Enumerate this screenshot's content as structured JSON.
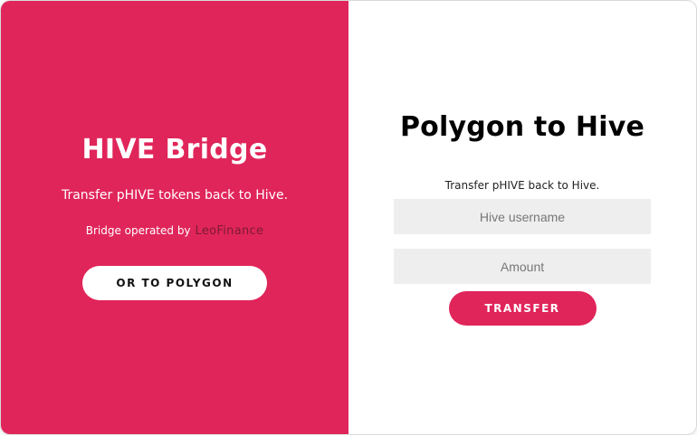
{
  "left_panel": {
    "title": "HIVE Bridge",
    "subtitle": "Transfer pHIVE tokens back to Hive.",
    "operated_by": "Bridge operated by",
    "operator_link": "LeoFinance",
    "switch_button": "OR TO POLYGON"
  },
  "right_panel": {
    "title": "Polygon to Hive",
    "subtitle": "Transfer pHIVE back to Hive.",
    "username": {
      "value": "",
      "placeholder": "Hive username"
    },
    "amount": {
      "value": "",
      "placeholder": "Amount"
    },
    "submit_button": "TRANSFER"
  },
  "colors": {
    "accent": "#e0255a",
    "panel_background": "#ffffff",
    "input_background": "#eeeeee"
  }
}
